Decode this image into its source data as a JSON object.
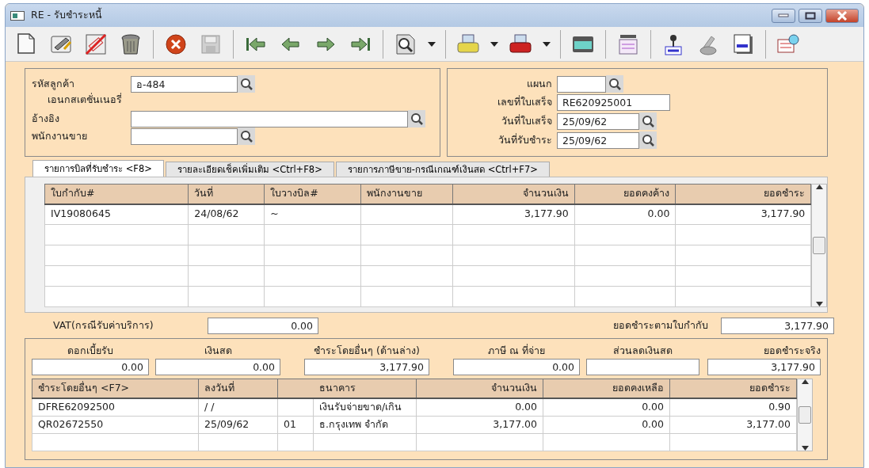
{
  "window": {
    "title": "RE - รับชำระหนี้"
  },
  "customer": {
    "code_label": "รหัสลูกค้า",
    "code_value": "อ-484",
    "name": "เอนกสเตชั่นเนอรี่",
    "reference_label": "อ้างอิง",
    "salesperson_label": "พนักงานขาย"
  },
  "document": {
    "department_label": "แผนก",
    "receipt_no_label": "เลขที่ใบเสร็จ",
    "receipt_no": "RE620925001",
    "receipt_date_label": "วันที่ใบเสร็จ",
    "receipt_date": "25/09/62",
    "payment_date_label": "วันที่รับชำระ",
    "payment_date": "25/09/62"
  },
  "tabs": [
    {
      "label": "รายการบิลที่รับชำระ <F8>",
      "selected": true
    },
    {
      "label": "รายละเอียดเช็คเพิ่มเติม  <Ctrl+F8>",
      "selected": false
    },
    {
      "label": "รายการภาษีขาย-กรณีเกณฑ์เงินสด <Ctrl+F7>",
      "selected": false
    }
  ],
  "invoice_table": {
    "columns": [
      "ใบกำกับ#",
      "วันที่",
      "ใบวางบิล#",
      "พนักงานขาย",
      "จำนวนเงิน",
      "ยอดคงค้าง",
      "ยอดชำระ"
    ],
    "rows": [
      {
        "cells": [
          "IV19080645",
          "24/08/62",
          "~",
          "",
          "3,177.90",
          "0.00",
          "3,177.90"
        ]
      }
    ]
  },
  "vat": {
    "label": "VAT(กรณีรับค่าบริการ)",
    "value": "0.00"
  },
  "paid_per_invoice": {
    "label": "ยอดชำระตามใบกำกับ",
    "value": "3,177.90"
  },
  "summary": [
    {
      "label": "ดอกเบี้ยรับ",
      "value": "0.00"
    },
    {
      "label": "เงินสด",
      "value": "0.00"
    },
    {
      "label": "ชำระโดยอื่นๆ (ด้านล่าง)",
      "value": "3,177.90"
    },
    {
      "label": "ภาษี ณ ที่จ่าย",
      "value": "0.00"
    },
    {
      "label": "ส่วนลดเงินสด"
    },
    {
      "label": "ยอดชำระจริง",
      "value": "3,177.90"
    }
  ],
  "payment_table": {
    "columns": [
      "ชำระโดยอื่นๆ <F7>",
      "ลงวันที่",
      "ธนาคาร",
      "จำนวนเงิน",
      "ยอดคงเหลือ",
      "ยอดชำระ"
    ],
    "rows": [
      {
        "cells": [
          "DFRE62092500",
          " /  /",
          "เงินรับจ่ายขาด/เกิน",
          "0.00",
          "0.00",
          "0.90"
        ]
      },
      {
        "cells": [
          "QR02672550",
          "25/09/62",
          "ธ.กรุงเทพ จำกัด",
          "3,177.00",
          "0.00",
          "3,177.00"
        ],
        "bank_code": "01"
      }
    ]
  }
}
